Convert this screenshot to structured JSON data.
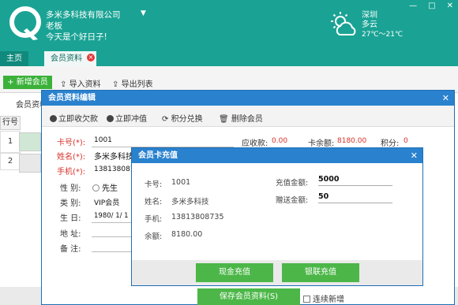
{
  "header": {
    "company": "多米多科技有限公司",
    "role": "老板",
    "greeting": "今天是个好日子!",
    "window_controls": [
      "—",
      "□",
      "✕"
    ]
  },
  "weather": {
    "city": "深圳",
    "condition": "多云",
    "temp": "27℃～21℃"
  },
  "tabs": {
    "home": "主页",
    "member": "会员资料"
  },
  "toolbar": {
    "add": "+ 新增会员",
    "import": "导入资料",
    "export": "导出列表"
  },
  "list": {
    "subtab": "会员资料",
    "col_no": "行号",
    "rows": [
      "1",
      "2"
    ]
  },
  "edit_dialog": {
    "title": "会员资料编辑",
    "close": "✕",
    "tools": [
      "立即收欠款",
      "立即冲值",
      "积分兑换",
      "删除会员"
    ],
    "fields": {
      "card_label": "卡号(*):",
      "card_value": "1001",
      "name_label": "姓名(*):",
      "name_value": "多米多科技",
      "phone_label": "手机(*):",
      "phone_value": "13813808735",
      "gender_label": "性  别:",
      "gender_value": "先生",
      "type_label": "类  别:",
      "type_value": "VIP会员",
      "birthday_label": "生  日:",
      "birthday_value": "1980/ 1/ 1",
      "address_label": "地  址:",
      "note_label": "备  注:"
    },
    "summary": {
      "receivable_label": "应收款:",
      "receivable_value": "0.00",
      "balance_label": "卡余额:",
      "balance_value": "8180.00",
      "points_label": "积分:",
      "points_value": "0"
    },
    "save_button": "保存会员资料(S)",
    "continue_label": "连续新增"
  },
  "recharge_dialog": {
    "title": "会员卡充值",
    "close": "✕",
    "card_label": "卡号:",
    "card_value": "1001",
    "name_label": "姓名:",
    "name_value": "多米多科技",
    "phone_label": "手机:",
    "phone_value": "13813808735",
    "balance_label": "余额:",
    "balance_value": "8180.00",
    "amount_label": "充值金额:",
    "amount_value": "5000",
    "bonus_label": "赠送金额:",
    "bonus_value": "50",
    "cash_button": "现金充值",
    "unionpay_button": "银联充值"
  },
  "colors": {
    "teal": "#1aa394",
    "blue": "#2a82cf",
    "green": "#4cb748",
    "red": "#d9302a"
  }
}
